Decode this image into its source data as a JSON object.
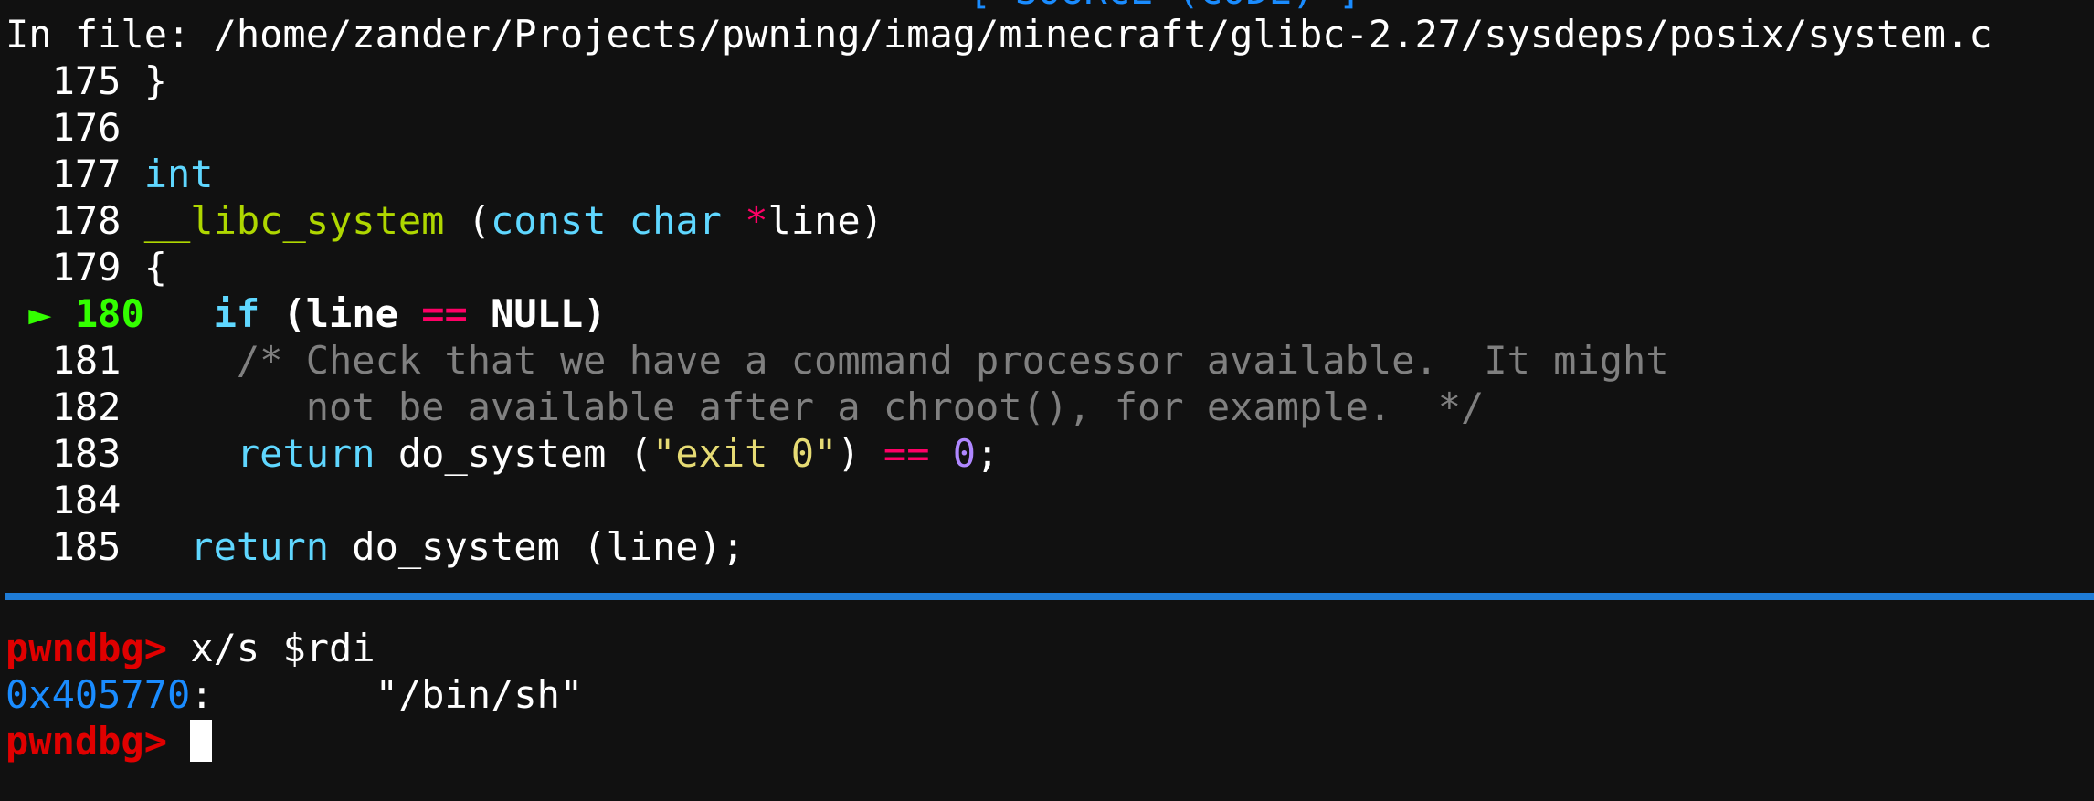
{
  "header": {
    "top_title": "[ SOURCE (CODE) ]",
    "file_label": "In file: /home/zander/Projects/pwning/imag/minecraft/glibc-2.27/sysdeps/posix/system.c"
  },
  "source": {
    "current_marker": "►",
    "lines": [
      {
        "num": "175",
        "text": "}"
      },
      {
        "num": "176",
        "text": ""
      },
      {
        "num": "177",
        "kw": "int"
      },
      {
        "num": "178",
        "fn": "__libc_system",
        "p1": " (",
        "kw1": "const",
        "sp": " ",
        "kw2": "char",
        "sp2": " ",
        "op": "*",
        "rest": "line)"
      },
      {
        "num": "179",
        "text": "{"
      },
      {
        "num": "180",
        "kw": "if",
        "a": " (line ",
        "op": "==",
        "b": " NULL)"
      },
      {
        "num": "181",
        "comment": "/* Check that we have a command processor available.  It might"
      },
      {
        "num": "182",
        "comment": "   not be available after a chroot(), for example.  */"
      },
      {
        "num": "183",
        "kw": "return",
        "a": " do_system (",
        "str": "\"exit 0\"",
        "b": ") ",
        "op": "==",
        "c": " ",
        "num_lit": "0",
        "d": ";"
      },
      {
        "num": "184",
        "text": ""
      },
      {
        "num": "185",
        "kw": "return",
        "a": " do_system (line);"
      }
    ]
  },
  "console": {
    "prompt": "pwndbg>",
    "command": "x/s $rdi",
    "result_addr": "0x405770",
    "result_sep": ":",
    "result_value": "\"/bin/sh\""
  },
  "colors": {
    "background": "#111111",
    "keyword": "#5fd7ff",
    "function": "#afd700",
    "operator": "#ff0066",
    "string": "#e6db74",
    "number": "#af87ff",
    "comment": "#808080",
    "address": "#1a8cff",
    "prompt": "#e00000",
    "current_line": "#33ff00",
    "separator": "#1e7bd6"
  }
}
